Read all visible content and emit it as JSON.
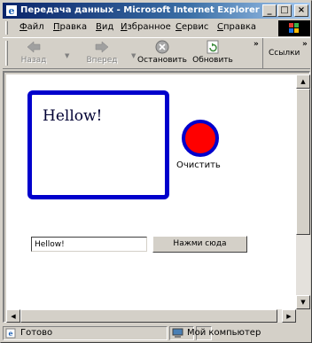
{
  "window": {
    "title": "Передача данных - Microsoft Internet Explorer",
    "controls": {
      "minimize": "_",
      "maximize": "□",
      "close": "×"
    }
  },
  "menu": {
    "items": [
      "Файл",
      "Правка",
      "Вид",
      "Избранное",
      "Сервис",
      "Справка"
    ]
  },
  "toolbar": {
    "back": "Назад",
    "forward": "Вперед",
    "stop": "Остановить",
    "refresh": "Обновить",
    "more": "»",
    "links_more": "»",
    "links": "Ссылки"
  },
  "page": {
    "greeting": "Hellow!",
    "clear_label": "Очистить",
    "input_value": "Hellow!",
    "button_label": "Нажми сюда",
    "dot_color": "#ff0000",
    "box_color": "#0000cc"
  },
  "statusbar": {
    "status": "Готово",
    "zone": "Мой компьютер"
  }
}
